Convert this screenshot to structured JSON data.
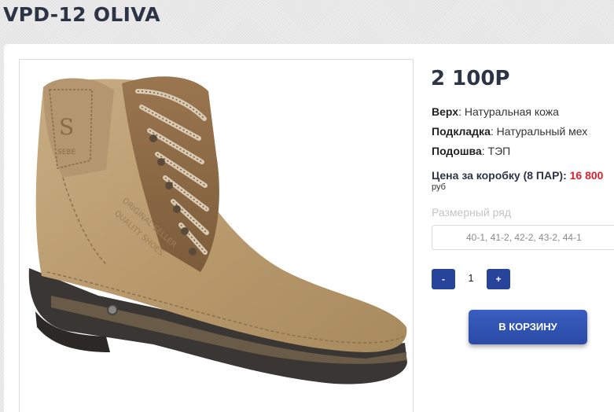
{
  "product": {
    "title": "VPD-12 OLIVA",
    "price": "2 100Р",
    "specs": [
      {
        "label": "Верх",
        "value": "Натуральная кожа"
      },
      {
        "label": "Подкладка",
        "value": "Натуральный мех"
      },
      {
        "label": "Подошва",
        "value": "ТЭП"
      }
    ],
    "box_price_label": "Цена за коробку (8 ПАР):",
    "box_price_value": "16 800",
    "box_price_unit": "руб",
    "size_label": "Размерный ряд",
    "size_value": "40-1, 41-2, 42-2, 43-2, 44-1",
    "image_logo_letter": "S",
    "image_logo_text": "SEBE",
    "image_emboss_1": "ORIGINAL SELLER",
    "image_emboss_2": "QUALITY SHOES"
  },
  "cart": {
    "minus_label": "-",
    "quantity": "1",
    "plus_label": "+",
    "add_button_label": "В КОРЗИНУ"
  },
  "colors": {
    "accent": "#27449a",
    "price_red": "#d9232d",
    "title": "#2c3446"
  }
}
